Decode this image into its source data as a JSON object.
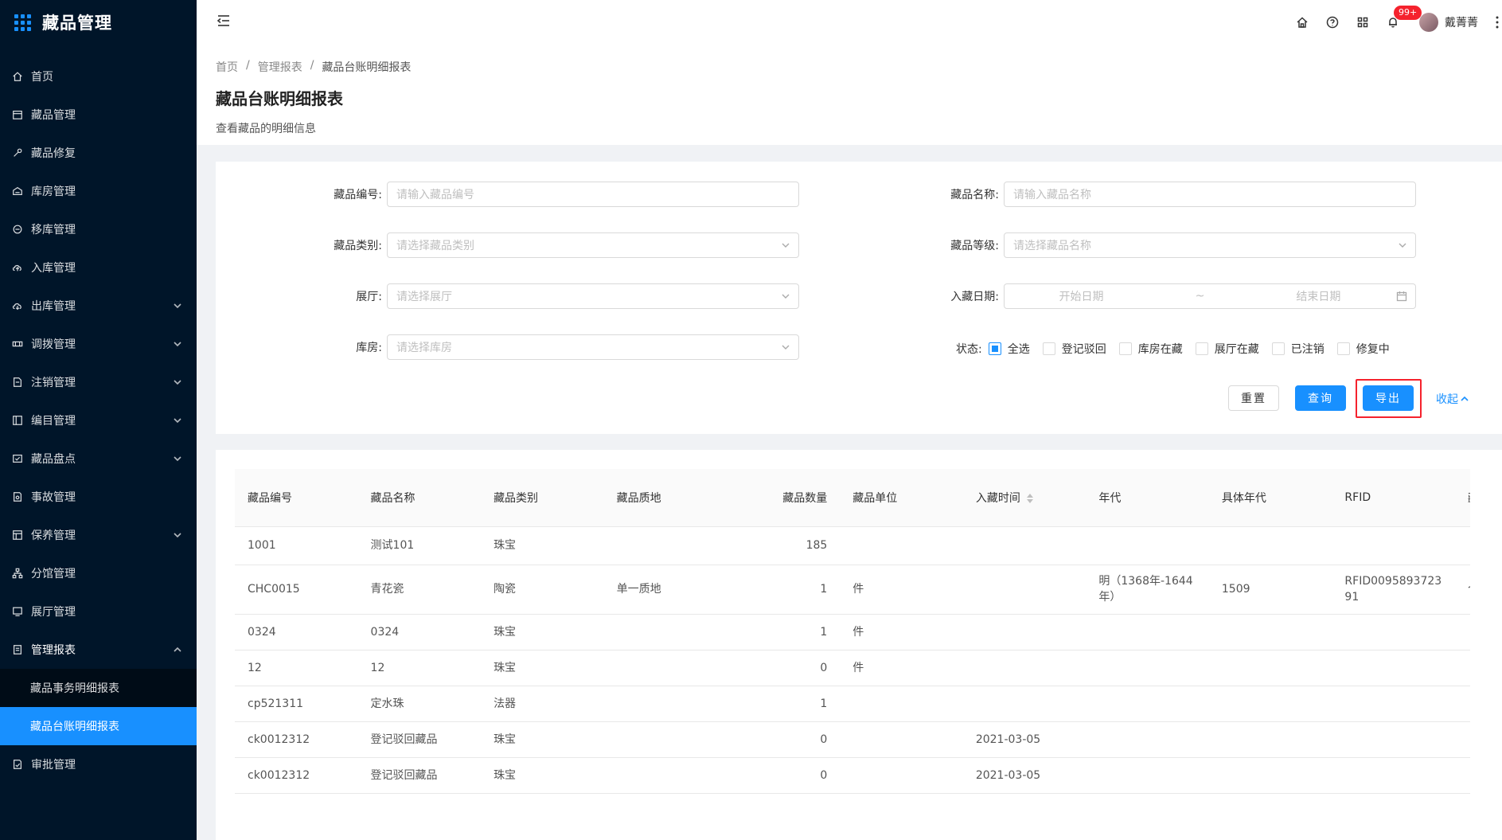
{
  "app": {
    "title": "藏品管理"
  },
  "sidebar": {
    "items": [
      {
        "label": "首页",
        "icon": "home-icon",
        "has_children": false
      },
      {
        "label": "藏品管理",
        "icon": "calendar-icon",
        "has_children": false
      },
      {
        "label": "藏品修复",
        "icon": "wrench-icon",
        "has_children": false
      },
      {
        "label": "库房管理",
        "icon": "warehouse-icon",
        "has_children": false
      },
      {
        "label": "移库管理",
        "icon": "move-icon",
        "has_children": false
      },
      {
        "label": "入库管理",
        "icon": "cloud-upload-icon",
        "has_children": false
      },
      {
        "label": "出库管理",
        "icon": "cloud-download-icon",
        "has_children": true
      },
      {
        "label": "调拨管理",
        "icon": "transfer-icon",
        "has_children": true
      },
      {
        "label": "注销管理",
        "icon": "file-icon",
        "has_children": true
      },
      {
        "label": "编目管理",
        "icon": "catalog-icon",
        "has_children": true
      },
      {
        "label": "藏品盘点",
        "icon": "inventory-icon",
        "has_children": true
      },
      {
        "label": "事故管理",
        "icon": "accident-icon",
        "has_children": false
      },
      {
        "label": "保养管理",
        "icon": "maintenance-icon",
        "has_children": true
      },
      {
        "label": "分馆管理",
        "icon": "branch-icon",
        "has_children": false
      },
      {
        "label": "展厅管理",
        "icon": "hall-icon",
        "has_children": false
      },
      {
        "label": "管理报表",
        "icon": "report-icon",
        "has_children": true,
        "open": true
      }
    ],
    "report_children": [
      {
        "label": "藏品事务明细报表",
        "active": false
      },
      {
        "label": "藏品台账明细报表",
        "active": true
      }
    ],
    "last_item": {
      "label": "审批管理",
      "icon": "approval-icon"
    }
  },
  "header": {
    "notification_count": "99+",
    "user_name": "戴菁菁"
  },
  "breadcrumb": [
    "首页",
    "管理报表",
    "藏品台账明细报表"
  ],
  "breadcrumb_sep": "/",
  "page": {
    "title": "藏品台账明细报表",
    "description": "查看藏品的明细信息"
  },
  "filters": {
    "code_label": "藏品编号:",
    "code_placeholder": "请输入藏品编号",
    "name_label": "藏品名称:",
    "name_placeholder": "请输入藏品名称",
    "category_label": "藏品类别:",
    "category_placeholder": "请选择藏品类别",
    "level_label": "藏品等级:",
    "level_placeholder": "请选择藏品名称",
    "hall_label": "展厅:",
    "hall_placeholder": "请选择展厅",
    "date_label": "入藏日期:",
    "date_start": "开始日期",
    "date_sep": "~",
    "date_end": "结束日期",
    "storage_label": "库房:",
    "storage_placeholder": "请选择库房",
    "status_label": "状态:",
    "status_options": [
      {
        "label": "全选",
        "checked": true
      },
      {
        "label": "登记驳回",
        "checked": false
      },
      {
        "label": "库房在藏",
        "checked": false
      },
      {
        "label": "展厅在藏",
        "checked": false
      },
      {
        "label": "已注销",
        "checked": false
      },
      {
        "label": "修复中",
        "checked": false
      }
    ],
    "reset_label": "重置",
    "query_label": "查询",
    "export_label": "导出",
    "collapse_label": "收起"
  },
  "table": {
    "columns": [
      "藏品编号",
      "藏品名称",
      "藏品类别",
      "藏品质地",
      "藏品数量",
      "藏品单位",
      "入藏时间",
      "年代",
      "具体年代",
      "RFID",
      "藏品来"
    ],
    "rows": [
      [
        "1001",
        "测试101",
        "珠宝",
        "",
        "185",
        "",
        "",
        "",
        "",
        "",
        ""
      ],
      [
        "CHC0015",
        "青花瓷",
        "陶瓷",
        "单一质地",
        "1",
        "件",
        "",
        "明（1368年-1644年）",
        "1509",
        "RFID009589372391",
        "个人捐"
      ],
      [
        "0324",
        "0324",
        "珠宝",
        "",
        "1",
        "件",
        "",
        "",
        "",
        "",
        ""
      ],
      [
        "12",
        "12",
        "珠宝",
        "",
        "0",
        "件",
        "",
        "",
        "",
        "",
        ""
      ],
      [
        "cp521311",
        "定水珠",
        "法器",
        "",
        "1",
        "",
        "",
        "",
        "",
        "",
        ""
      ],
      [
        "ck0012312",
        "登记驳回藏品",
        "珠宝",
        "",
        "0",
        "",
        "2021-03-05",
        "",
        "",
        "",
        ""
      ],
      [
        "ck0012312",
        "登记驳回藏品",
        "珠宝",
        "",
        "0",
        "",
        "2021-03-05",
        "",
        "",
        "",
        ""
      ]
    ]
  },
  "colors": {
    "sidebar_bg": "#001529",
    "submenu_bg": "#000c17",
    "primary": "#1890ff",
    "danger": "#f5222d"
  }
}
